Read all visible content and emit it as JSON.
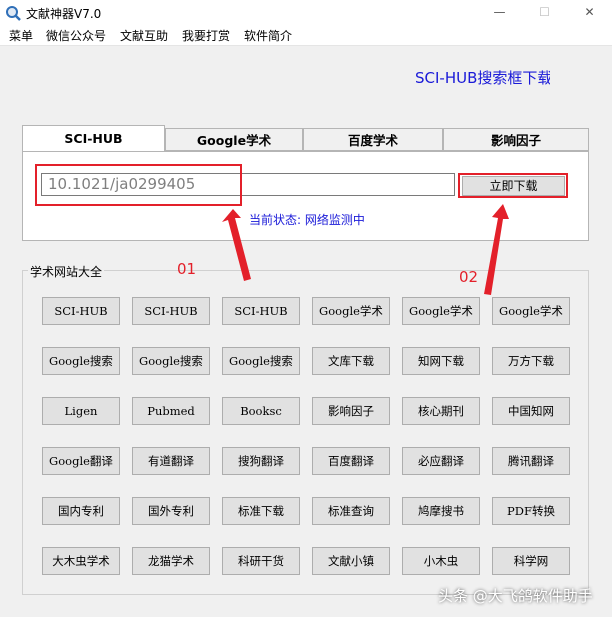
{
  "window": {
    "title": "文献神器V7.0",
    "minimize": "—",
    "maximize": "☐",
    "close": "✕"
  },
  "menu": [
    "菜单",
    "微信公众号",
    "文献互助",
    "我要打赏",
    "软件简介"
  ],
  "marquee": "SCI-HUB搜索框下载",
  "tabs": [
    "SCI-HUB",
    "Google学术",
    "百度学术",
    "影响因子"
  ],
  "search": {
    "value": "10.1021/ja0299405"
  },
  "download_button": "立即下载",
  "status": "当前状态: 网络监测中",
  "group_title": "学术网站大全",
  "site_buttons": [
    [
      "SCI-HUB",
      "SCI-HUB",
      "SCI-HUB",
      "Google学术",
      "Google学术",
      "Google学术"
    ],
    [
      "Google搜索",
      "Google搜索",
      "Google搜索",
      "文库下载",
      "知网下载",
      "万方下载"
    ],
    [
      "Ligen",
      "Pubmed",
      "Booksc",
      "影响因子",
      "核心期刊",
      "中国知网"
    ],
    [
      "Google翻译",
      "有道翻译",
      "搜狗翻译",
      "百度翻译",
      "必应翻译",
      "腾讯翻译"
    ],
    [
      "国内专利",
      "国外专利",
      "标准下载",
      "标准查询",
      "鸠摩搜书",
      "PDF转换"
    ],
    [
      "大木虫学术",
      "龙猫学术",
      "科研干货",
      "文献小镇",
      "小木虫",
      "科学网"
    ]
  ],
  "annotations": {
    "label1": "01",
    "label2": "02",
    "color": "#e3202a"
  },
  "watermark": "头条 @大飞鸽软件助手",
  "colors": {
    "link_blue": "#1a1ad8",
    "annotation_red": "#e3202a"
  }
}
